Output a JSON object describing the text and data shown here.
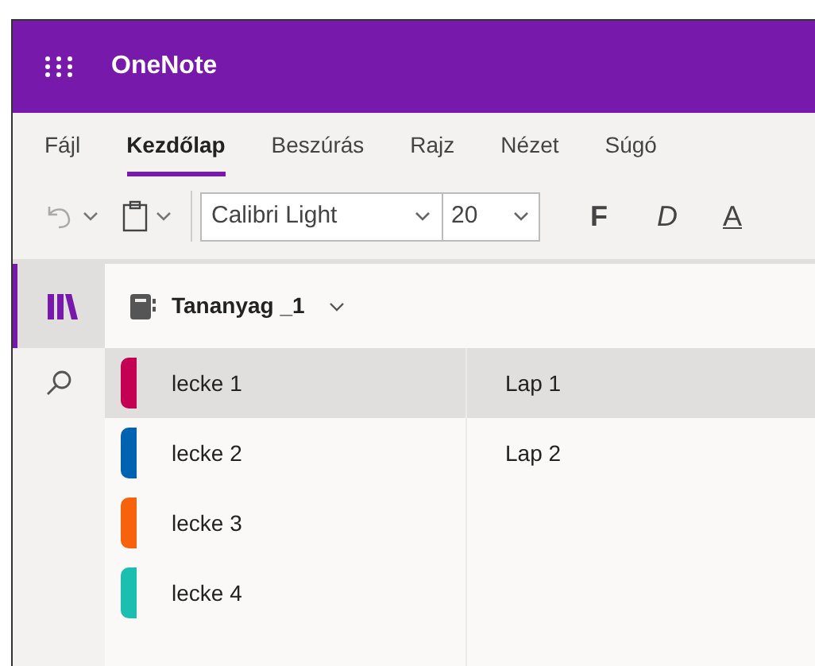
{
  "app_bar": {
    "title": "OneNote"
  },
  "tabs": [
    {
      "label": "Fájl",
      "selected": false
    },
    {
      "label": "Kezdőlap",
      "selected": true
    },
    {
      "label": "Beszúrás",
      "selected": false
    },
    {
      "label": "Rajz",
      "selected": false
    },
    {
      "label": "Nézet",
      "selected": false
    },
    {
      "label": "Súgó",
      "selected": false
    }
  ],
  "toolbar": {
    "font_name": "Calibri Light",
    "font_size": "20",
    "bold": "F",
    "italic": "D",
    "underline": "A"
  },
  "rail": [
    {
      "kind": "notebooks",
      "selected": true
    },
    {
      "kind": "search",
      "selected": false
    }
  ],
  "notebook": {
    "name": "Tananyag _1"
  },
  "sections": [
    {
      "name": "lecke 1",
      "color": "#c30052",
      "selected": true
    },
    {
      "name": "lecke 2",
      "color": "#0063b1",
      "selected": false
    },
    {
      "name": "lecke 3",
      "color": "#f7630c",
      "selected": false
    },
    {
      "name": "lecke 4",
      "color": "#1bbfaf",
      "selected": false
    }
  ],
  "pages": [
    {
      "name": "Lap 1",
      "selected": true
    },
    {
      "name": "Lap 2",
      "selected": false
    }
  ]
}
